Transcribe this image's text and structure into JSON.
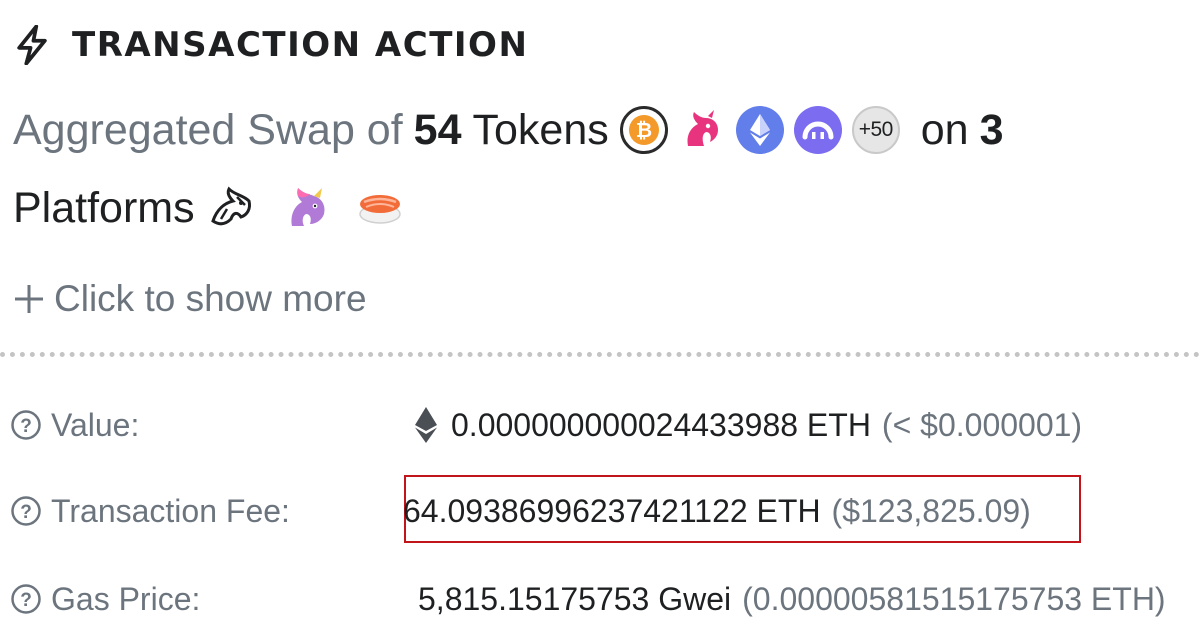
{
  "header": {
    "icon": "lightning-bolt-icon",
    "title": "TRANSACTION ACTION"
  },
  "action": {
    "prefix": "Aggregated Swap of",
    "token_count": "54",
    "tokens_word": "Tokens",
    "on_word": "on",
    "platform_count": "3",
    "platforms_word": "Platforms",
    "token_icons": [
      "bitcoin-token-icon",
      "uniswap-token-icon",
      "ethereum-token-icon",
      "pool-token-icon"
    ],
    "more_tokens": "+50",
    "platform_icons": [
      "1inch-platform-icon",
      "uniswap-platform-icon",
      "sushiswap-platform-icon"
    ]
  },
  "show_more": {
    "icon": "plus-icon",
    "label": "Click to show more"
  },
  "details": {
    "value": {
      "label": "Value:",
      "amount": "0.000000000024433988 ETH",
      "usd": "(< $0.000001)"
    },
    "fee": {
      "label": "Transaction Fee:",
      "amount": "64.09386996237421122 ETH",
      "usd": "($123,825.09)"
    },
    "gas": {
      "label": "Gas Price:",
      "amount": "5,815.15175753 Gwei",
      "eth": "(0.00000581515175753 ETH)"
    }
  },
  "colors": {
    "highlight_border": "#c2151b",
    "muted_text": "#6c757e",
    "dark_text": "#1e2022"
  }
}
